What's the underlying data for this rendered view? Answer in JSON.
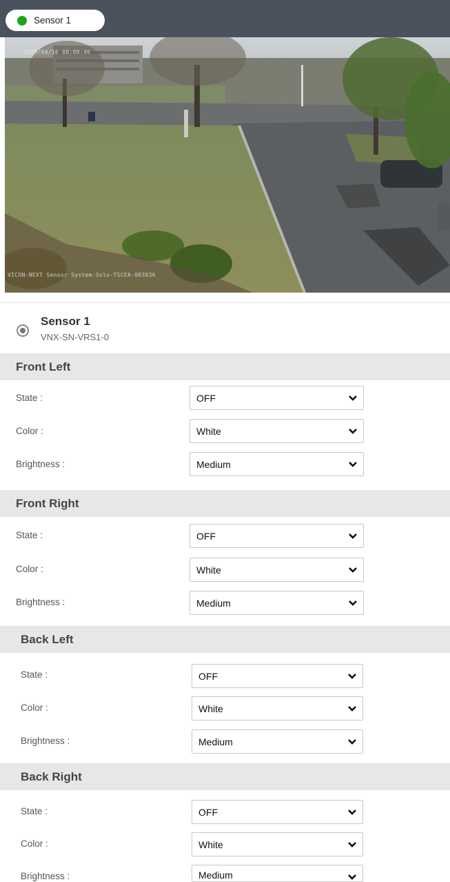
{
  "header": {
    "sensor_tab_label": "Sensor 1",
    "status_color": "#1aa51f"
  },
  "camera": {
    "timestamp_overlay": "2025/04/16 08:00:46",
    "caption_overlay": "VICON-NEXT Sensor System-Solo-TSCEA-003836"
  },
  "sensor": {
    "name": "Sensor 1",
    "model": "VNX-SN-VRS1-0"
  },
  "sections": [
    {
      "title": "Front Left",
      "fields": [
        {
          "label": "State :",
          "value": "OFF"
        },
        {
          "label": "Color :",
          "value": "White"
        },
        {
          "label": "Brightness :",
          "value": "Medium"
        }
      ]
    },
    {
      "title": "Front Right",
      "fields": [
        {
          "label": "State :",
          "value": "OFF"
        },
        {
          "label": "Color :",
          "value": "White"
        },
        {
          "label": "Brightness :",
          "value": "Medium"
        }
      ]
    },
    {
      "title": "Back Left",
      "fields": [
        {
          "label": "State :",
          "value": "OFF"
        },
        {
          "label": "Color :",
          "value": "White"
        },
        {
          "label": "Brightness :",
          "value": "Medium"
        }
      ]
    },
    {
      "title": "Back Right",
      "fields": [
        {
          "label": "State :",
          "value": "OFF"
        },
        {
          "label": "Color :",
          "value": "White"
        },
        {
          "label": "Brightness :",
          "value": "Medium"
        }
      ]
    }
  ]
}
